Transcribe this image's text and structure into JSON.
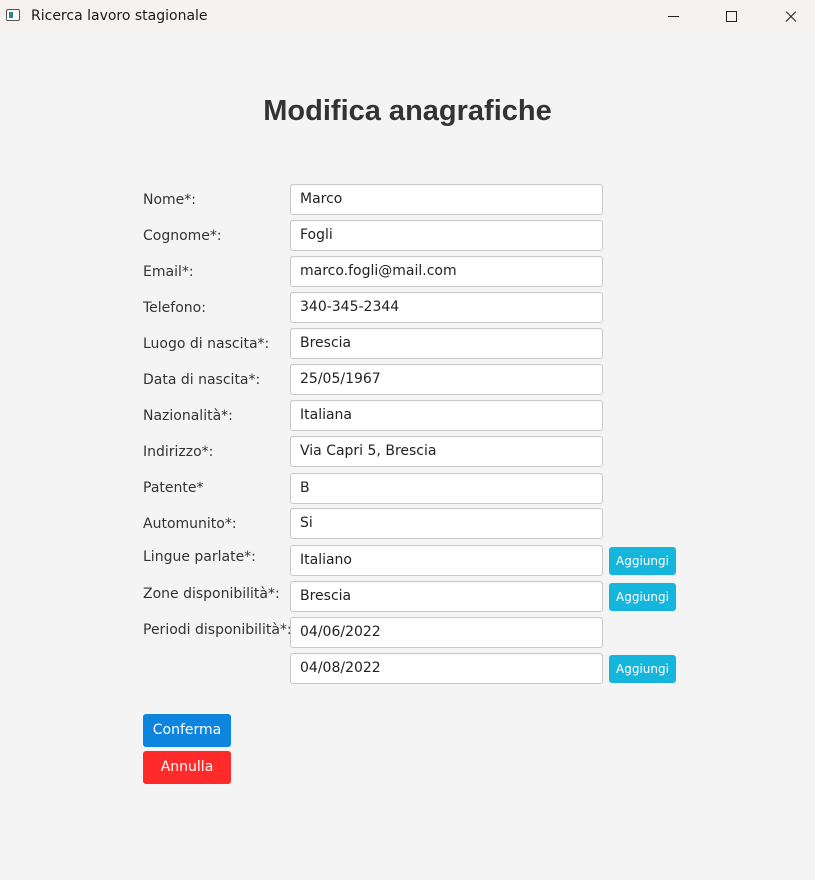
{
  "window": {
    "title": "Ricerca lavoro stagionale"
  },
  "page": {
    "title": "Modifica anagrafiche"
  },
  "form": {
    "nome": {
      "label": "Nome*:",
      "value": "Marco"
    },
    "cognome": {
      "label": "Cognome*:",
      "value": "Fogli"
    },
    "email": {
      "label": "Email*:",
      "value": "marco.fogli@mail.com"
    },
    "telefono": {
      "label": "Telefono:",
      "value": "340-345-2344"
    },
    "luogo_nascita": {
      "label": "Luogo di nascita*:",
      "value": "Brescia"
    },
    "data_nascita": {
      "label": "Data di nascita*:",
      "value": "25/05/1967"
    },
    "nazionalita": {
      "label": "Nazionalità*:",
      "value": "Italiana"
    },
    "indirizzo": {
      "label": "Indirizzo*:",
      "value": "Via Capri 5, Brescia"
    },
    "patente": {
      "label": "Patente*",
      "value": "B"
    },
    "automunito": {
      "label": "Automunito*:",
      "value": "Si"
    },
    "lingue": {
      "label": "Lingue parlate*:",
      "value": "Italiano",
      "add_label": "Aggiungi"
    },
    "zone": {
      "label": "Zone disponibilità*:",
      "value": "Brescia",
      "add_label": "Aggiungi"
    },
    "periodi": {
      "label": "Periodi disponibilità*:",
      "start": "04/06/2022",
      "end": "04/08/2022",
      "add_label": "Aggiungi"
    }
  },
  "actions": {
    "confirm_label": "Conferma",
    "cancel_label": "Annulla"
  },
  "colors": {
    "confirm": "#0d84de",
    "cancel": "#ff2a2a",
    "add": "#16b6dc"
  }
}
